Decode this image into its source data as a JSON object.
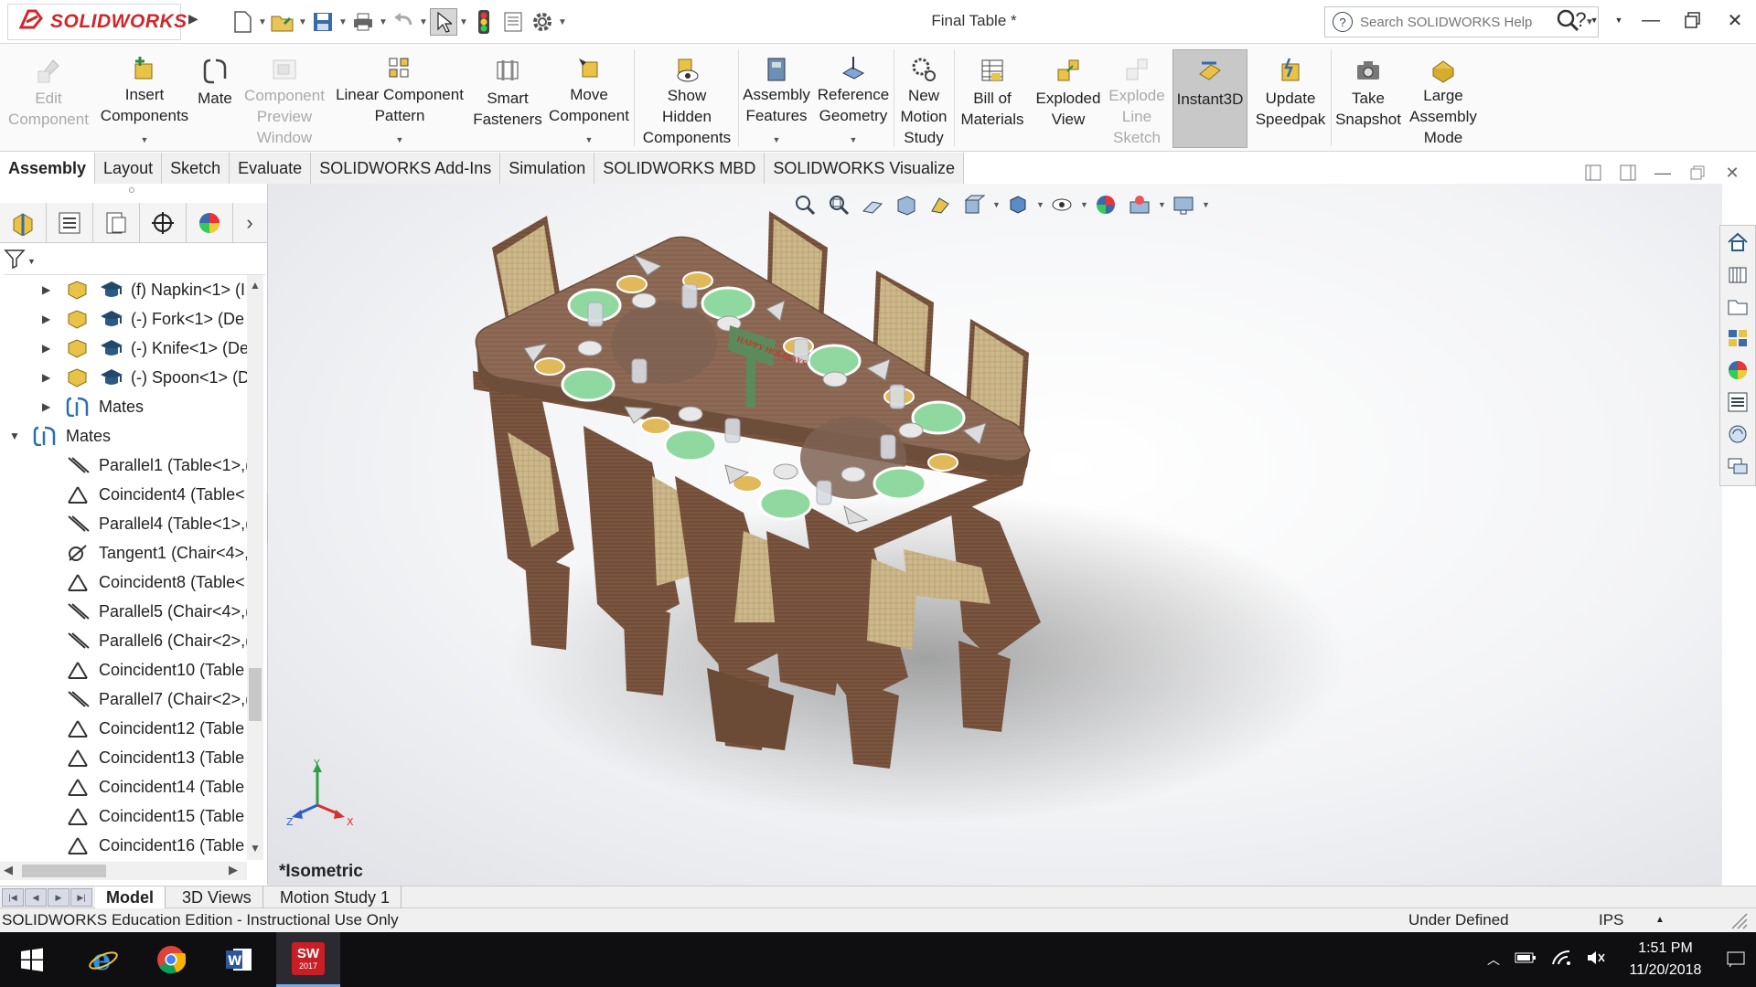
{
  "app": {
    "brand": "SOLIDWORKS",
    "document_title": "Final Table *",
    "search_placeholder": "Search SOLIDWORKS Help"
  },
  "ribbon": {
    "buttons": [
      {
        "label": "Edit\nComponent",
        "icon": "edit-component-icon",
        "enabled": false,
        "dropdown": false
      },
      {
        "label": "Insert\nComponents",
        "icon": "insert-components-icon",
        "enabled": true,
        "dropdown": true
      },
      {
        "label": "Mate",
        "icon": "mate-icon",
        "enabled": true,
        "dropdown": false
      },
      {
        "label": "Component\nPreview\nWindow",
        "icon": "component-preview-icon",
        "enabled": false,
        "dropdown": false
      },
      {
        "label": "Linear Component\nPattern",
        "icon": "linear-pattern-icon",
        "enabled": true,
        "dropdown": true
      },
      {
        "label": "Smart\nFasteners",
        "icon": "smart-fasteners-icon",
        "enabled": true,
        "dropdown": false
      },
      {
        "label": "Move\nComponent",
        "icon": "move-component-icon",
        "enabled": true,
        "dropdown": true
      },
      {
        "label": "Show\nHidden\nComponents",
        "icon": "show-hidden-icon",
        "enabled": true,
        "dropdown": false
      },
      {
        "label": "Assembly\nFeatures",
        "icon": "assembly-features-icon",
        "enabled": true,
        "dropdown": true
      },
      {
        "label": "Reference\nGeometry",
        "icon": "reference-geometry-icon",
        "enabled": true,
        "dropdown": true
      },
      {
        "label": "New\nMotion\nStudy",
        "icon": "motion-study-icon",
        "enabled": true,
        "dropdown": false
      },
      {
        "label": "Bill of\nMaterials",
        "icon": "bill-of-materials-icon",
        "enabled": true,
        "dropdown": false
      },
      {
        "label": "Exploded\nView",
        "icon": "exploded-view-icon",
        "enabled": true,
        "dropdown": false
      },
      {
        "label": "Explode\nLine\nSketch",
        "icon": "explode-line-icon",
        "enabled": false,
        "dropdown": false
      },
      {
        "label": "Instant3D",
        "icon": "instant3d-icon",
        "enabled": true,
        "dropdown": false,
        "active": true
      },
      {
        "label": "Update\nSpeedpak",
        "icon": "speedpak-icon",
        "enabled": true,
        "dropdown": false
      },
      {
        "label": "Take\nSnapshot",
        "icon": "camera-icon",
        "enabled": true,
        "dropdown": false
      },
      {
        "label": "Large\nAssembly\nMode",
        "icon": "large-assembly-icon",
        "enabled": true,
        "dropdown": false
      }
    ]
  },
  "command_tabs": [
    "Assembly",
    "Layout",
    "Sketch",
    "Evaluate",
    "SOLIDWORKS Add-Ins",
    "Simulation",
    "SOLIDWORKS MBD",
    "SOLIDWORKS Visualize"
  ],
  "active_command_tab": "Assembly",
  "tree": {
    "components": [
      {
        "label": "(f) Napkin<1> (I"
      },
      {
        "label": "(-) Fork<1> (De"
      },
      {
        "label": "(-) Knife<1> (De"
      },
      {
        "label": "(-) Spoon<1> (D"
      }
    ],
    "sub_mates_label": "Mates",
    "mates_folder": "Mates",
    "mates": [
      {
        "label": "Parallel1 (Table<1>,(",
        "type": "parallel"
      },
      {
        "label": "Coincident4 (Table<",
        "type": "coincident"
      },
      {
        "label": "Parallel4 (Table<1>,(",
        "type": "parallel"
      },
      {
        "label": "Tangent1 (Chair<4>,",
        "type": "tangent"
      },
      {
        "label": "Coincident8 (Table<",
        "type": "coincident"
      },
      {
        "label": "Parallel5 (Chair<4>,(",
        "type": "parallel"
      },
      {
        "label": "Parallel6 (Chair<2>,(",
        "type": "parallel"
      },
      {
        "label": "Coincident10 (Table",
        "type": "coincident"
      },
      {
        "label": "Parallel7 (Chair<2>,(",
        "type": "parallel"
      },
      {
        "label": "Coincident12 (Table",
        "type": "coincident"
      },
      {
        "label": "Coincident13 (Table",
        "type": "coincident"
      },
      {
        "label": "Coincident14 (Table",
        "type": "coincident"
      },
      {
        "label": "Coincident15 (Table",
        "type": "coincident"
      },
      {
        "label": "Coincident16 (Table",
        "type": "coincident"
      }
    ]
  },
  "viewport": {
    "view_name": "*Isometric",
    "centerpiece_text": "HAPPY HOLIDAYS",
    "triad": {
      "x": "X",
      "y": "Y",
      "z": "Z"
    }
  },
  "bottom_tabs": [
    "Model",
    "3D Views",
    "Motion Study 1"
  ],
  "active_bottom_tab": "Model",
  "status": {
    "left": "SOLIDWORKS Education Edition - Instructional Use Only",
    "state": "Under Defined",
    "units": "IPS"
  },
  "taskbar": {
    "apps": [
      "windows-start-icon",
      "internet-explorer-icon",
      "chrome-icon",
      "word-icon",
      "solidworks-2017-icon"
    ],
    "sw_badge": "SW",
    "sw_year": "2017",
    "time": "1:51 PM",
    "date": "11/20/2018"
  },
  "colors": {
    "brand_red": "#d1262b",
    "wood": "#7a5640",
    "plate_green": "#8fd9a0",
    "wicker": "#c9b58a"
  }
}
